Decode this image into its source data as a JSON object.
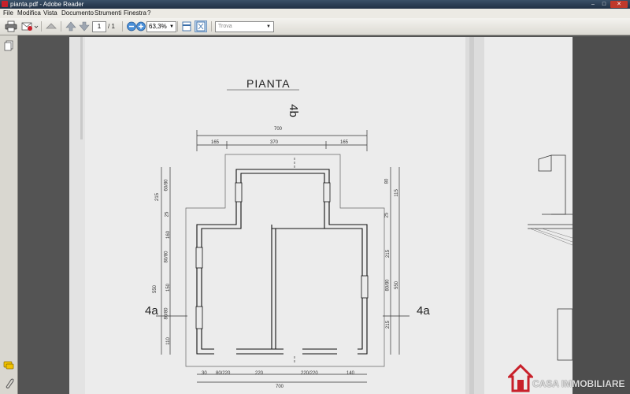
{
  "window": {
    "title": "pianta.pdf - Adobe Reader"
  },
  "menu": {
    "items": [
      "File",
      "Modifica",
      "Vista",
      "Documento",
      "Strumenti",
      "Finestra",
      "?"
    ]
  },
  "toolbar": {
    "page_current": "1",
    "page_total": "/ 1",
    "zoom": "63,3%",
    "find_placeholder": "Trova"
  },
  "drawing": {
    "title": "PIANTA",
    "north_mark": "4b",
    "section_left": "4a",
    "section_right": "4a",
    "dims_top": {
      "overall": "700",
      "left": "165",
      "center": "370",
      "right": "165"
    },
    "dims_left": [
      "215",
      "60/80",
      "25",
      "160",
      "80/80",
      "150",
      "80/80",
      "110"
    ],
    "dims_left_total": "550",
    "dims_right": [
      "80",
      "115",
      "25",
      "215",
      "80/80",
      "215"
    ],
    "dims_right_total": "550",
    "dims_bottom": [
      "30",
      "80/220",
      "220",
      "220/220",
      "140"
    ],
    "dims_bottom_total": "700"
  },
  "watermark": {
    "text": "CASA IMMOBILIARE"
  },
  "colors": {
    "accent": "#c8202a",
    "titlebar": "#1f2f44",
    "page": "#ececec"
  }
}
